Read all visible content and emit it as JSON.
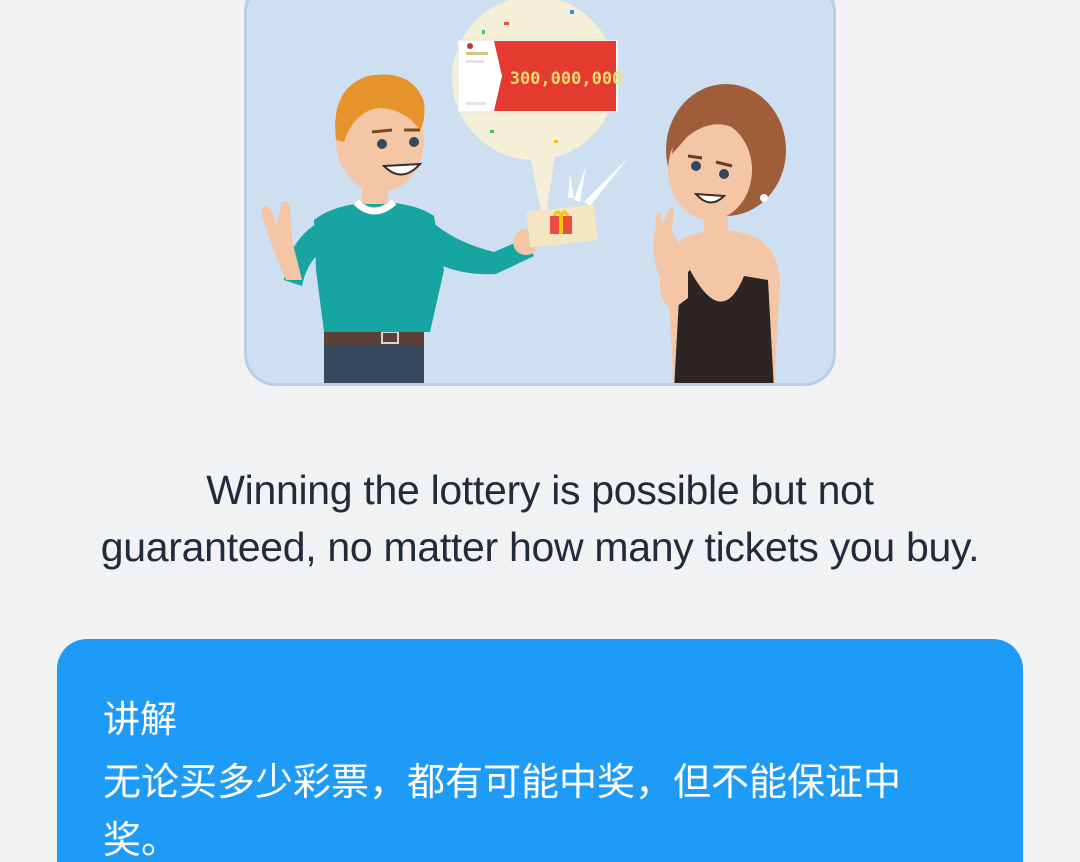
{
  "illustration": {
    "ticket_amount": "300,000,000",
    "icons": [
      "man-figure",
      "woman-figure",
      "speech-bubble",
      "lottery-ticket",
      "gift-icon",
      "sparkle-icon"
    ]
  },
  "sentence": {
    "line1": "Winning the lottery is possible but not",
    "line2": "guaranteed, no matter how many tickets you buy."
  },
  "explanation": {
    "title": "讲解",
    "text": "无论买多少彩票，都有可能中奖，但不能保证中奖。"
  },
  "colors": {
    "background": "#f1f2f4",
    "card": "#1e9bf6",
    "text": "#222b3a",
    "illustration_bg": "#cddff0"
  }
}
